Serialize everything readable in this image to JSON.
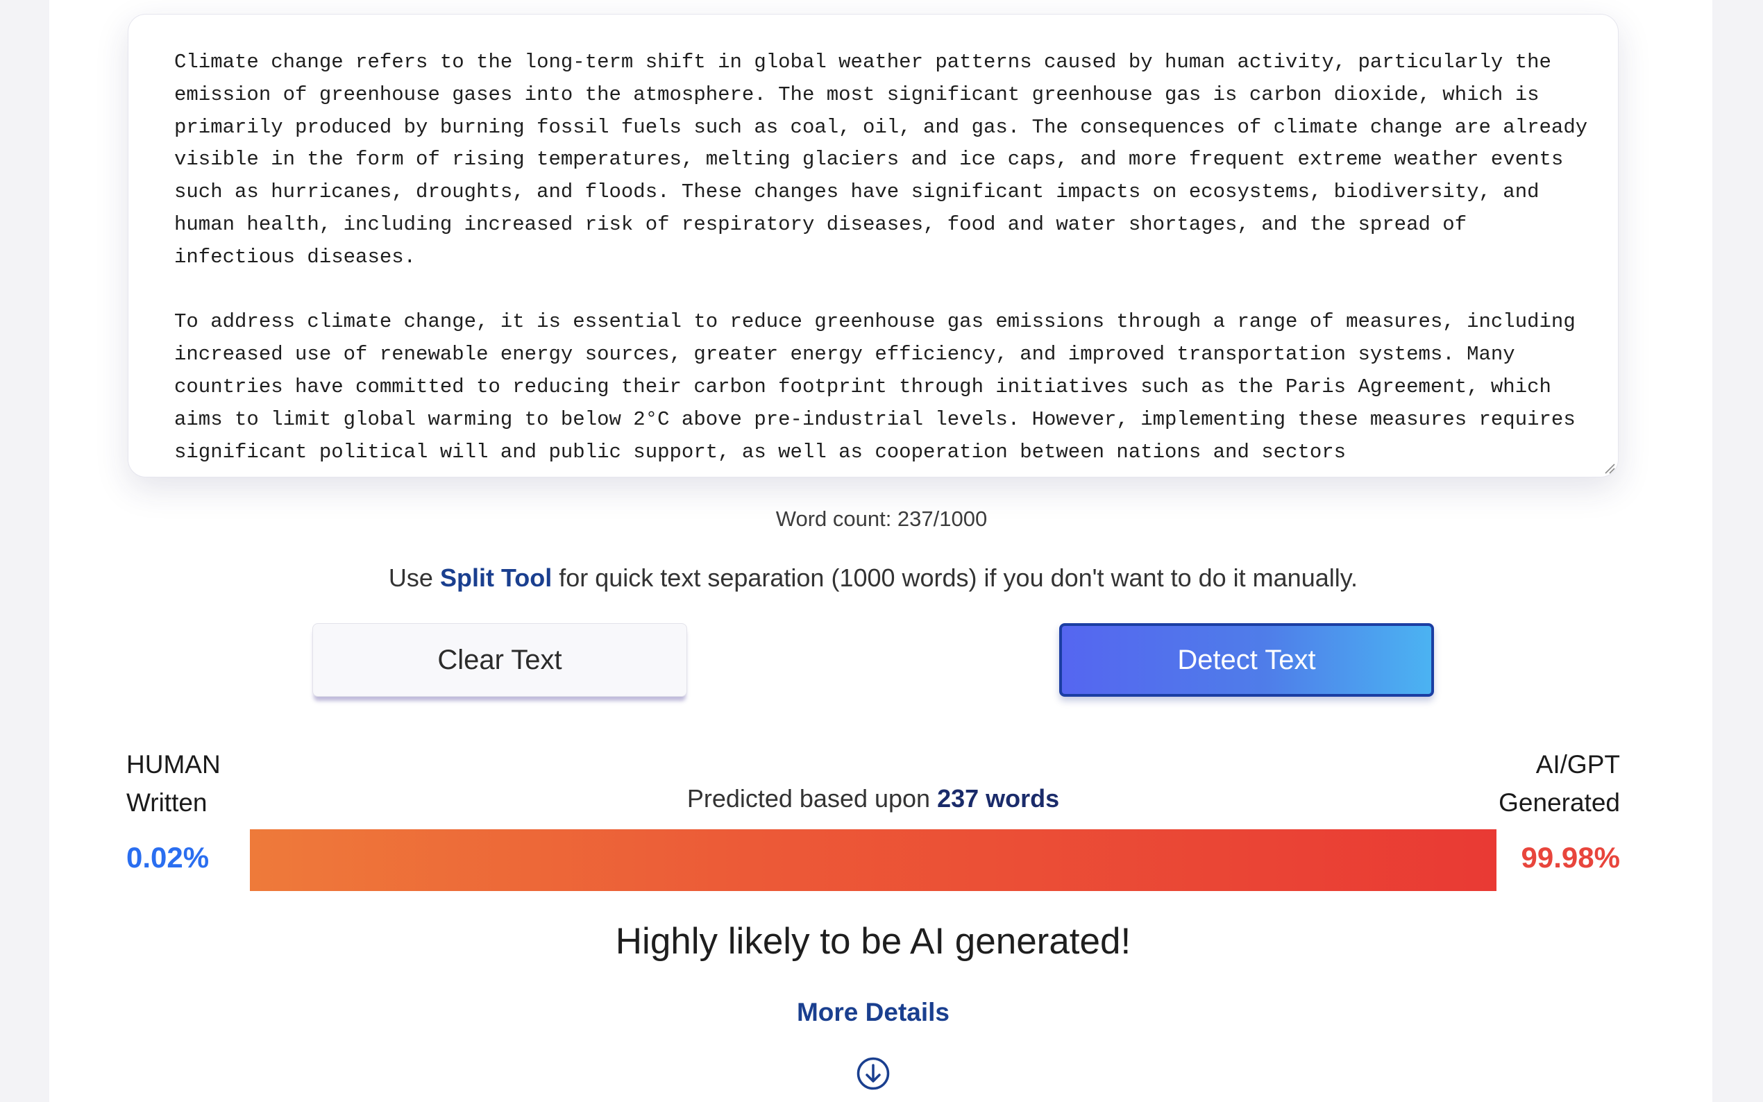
{
  "editor": {
    "paragraphs": [
      "Climate change refers to the long-term shift in global weather patterns caused by human activity, particularly the emission of greenhouse gases into the atmosphere. The most significant greenhouse gas is carbon dioxide, which is primarily produced by burning fossil fuels such as coal, oil, and gas. The consequences of climate change are already visible in the form of rising temperatures, melting glaciers and ice caps, and more frequent extreme weather events such as hurricanes, droughts, and floods. These changes have significant impacts on ecosystems, biodiversity, and human health, including increased risk of respiratory diseases, food and water shortages, and the spread of infectious diseases.",
      "To address climate change, it is essential to reduce greenhouse gas emissions through a range of measures, including increased use of renewable energy sources, greater energy efficiency, and improved transportation systems. Many countries have committed to reducing their carbon footprint through initiatives such as the Paris Agreement, which aims to limit global warming to below 2°C above pre-industrial levels. However, implementing these measures requires significant political will and public support, as well as cooperation between nations and sectors"
    ]
  },
  "word_count": "Word count: 237/1000",
  "hint": {
    "before": "Use ",
    "link": "Split Tool",
    "after": " for quick text separation (1000 words) if you don't want to do it manually."
  },
  "buttons": {
    "clear": "Clear Text",
    "detect": "Detect Text"
  },
  "result": {
    "human_label_1": "HUMAN",
    "human_label_2": "Written",
    "ai_label_1": "AI/GPT",
    "ai_label_2": "Generated",
    "predicted_prefix": "Predicted based upon ",
    "predicted_words": "237 words",
    "human_pct": "0.02%",
    "ai_pct": "99.98%",
    "human_fraction": 0.0002,
    "ai_fraction": 0.9998,
    "verdict": "Highly likely to be AI generated!",
    "more_details": "More Details"
  },
  "icons": {
    "down": "arrow-down-circle-icon",
    "resize": "resize-handle-icon"
  },
  "colors": {
    "accent_blue": "#1a3f8f",
    "human_blue": "#2a6ef0",
    "ai_red": "#e8453c"
  }
}
